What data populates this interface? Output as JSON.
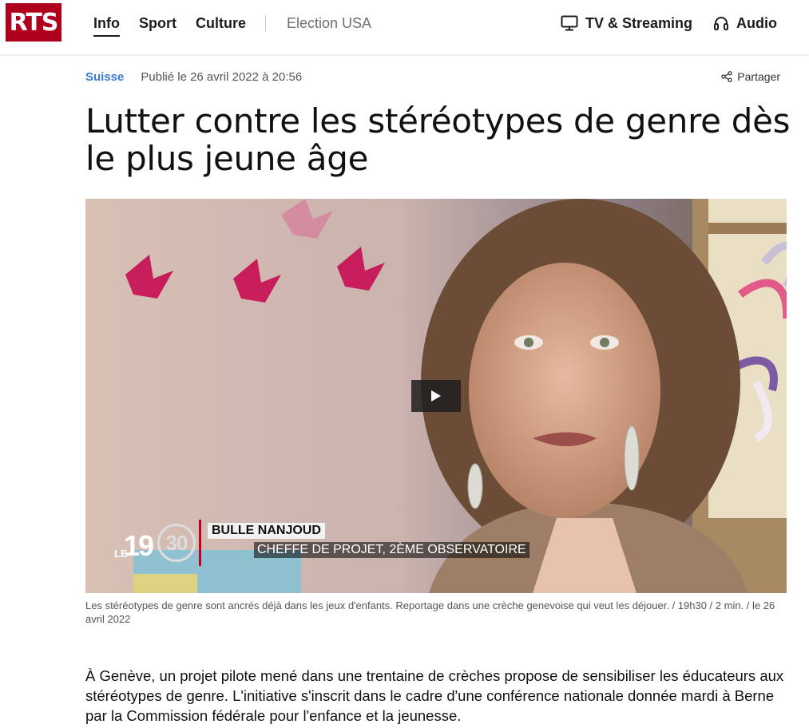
{
  "header": {
    "logo": "RTS",
    "nav": [
      {
        "label": "Info"
      },
      {
        "label": "Sport"
      },
      {
        "label": "Culture"
      },
      {
        "label": "Election USA"
      }
    ],
    "tv_streaming": "TV & Streaming",
    "audio": "Audio"
  },
  "article": {
    "category": "Suisse",
    "published": "Publié le 26 avril 2022 à 20:56",
    "share": "Partager",
    "title": "Lutter contre les stéréotypes de genre dès le plus jeune âge",
    "video": {
      "brand_le": "LE",
      "brand_19": "19",
      "brand_30": "30",
      "lower_third_name": "BULLE NANJOUD",
      "lower_third_role": "CHEFFE DE PROJET, 2ÈME OBSERVATOIRE"
    },
    "caption": "Les stéréotypes de genre sont ancrés déjà dans les jeux d'enfants. Reportage dans une crèche genevoise qui veut les déjouer. / 19h30 / 2 min. / le 26 avril 2022",
    "lead": "À Genève, un projet pilote mené dans une trentaine de crèches propose de sensibiliser les éducateurs aux stéréotypes de genre. L'initiative s'inscrit dans le cadre d'une conférence nationale donnée mardi à Berne par la Commission fédérale pour l'enfance et la jeunesse."
  },
  "colors": {
    "brand_red": "#af001e",
    "category_blue": "#3a7bd5"
  },
  "icons": [
    "monitor-icon",
    "headphones-icon",
    "share-icon",
    "play-icon"
  ]
}
